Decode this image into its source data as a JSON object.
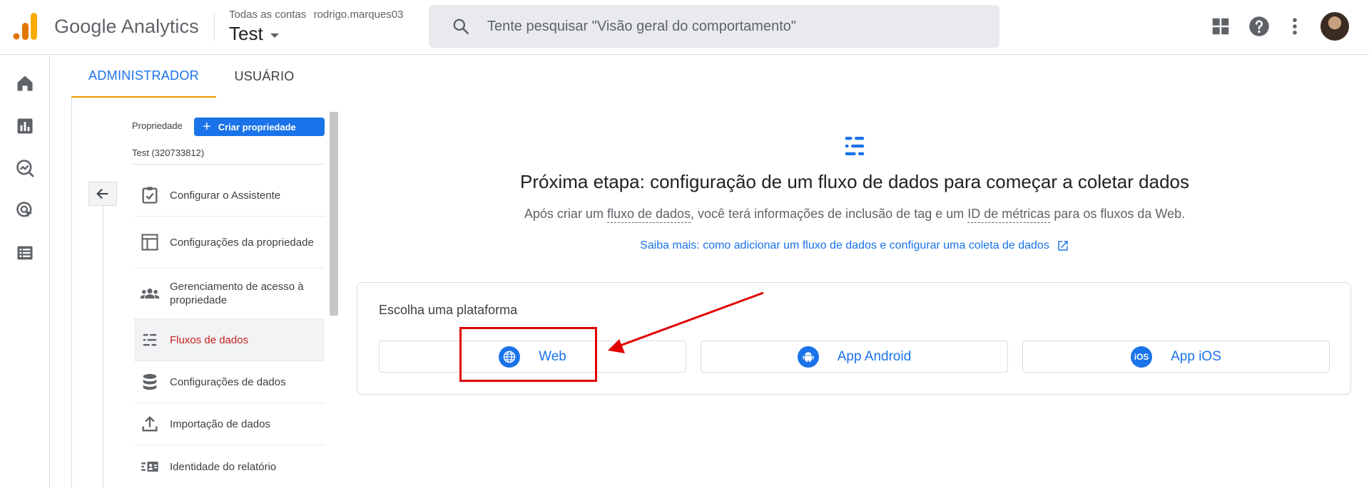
{
  "header": {
    "brand": "Google Analytics",
    "account_crumb": "Todas as contas",
    "account_user": "rodrigo.marques03",
    "property_name": "Test",
    "search_placeholder": "Tente pesquisar \"Visão geral do comportamento\"",
    "icons": [
      "apps-grid-icon",
      "help-icon",
      "more-vert-icon",
      "user-avatar"
    ]
  },
  "rail": {
    "icons": [
      "home-icon",
      "reports-icon",
      "explore-icon",
      "advertising-icon",
      "configure-icon"
    ]
  },
  "tabs": [
    {
      "label": "ADMINISTRADOR",
      "active": true
    },
    {
      "label": "USUÁRIO",
      "active": false
    }
  ],
  "property_panel": {
    "label": "Propriedade",
    "create_button": "Criar propriedade",
    "property_id": "Test (320733812)",
    "nav": [
      {
        "label": "Configurar o Assistente",
        "icon": "checklist-icon"
      },
      {
        "label": "Configurações da propriedade",
        "icon": "property-settings-icon"
      },
      {
        "label": "Gerenciamento de acesso à propriedade",
        "icon": "people-icon"
      },
      {
        "label": "Fluxos de dados",
        "icon": "data-streams-icon",
        "selected": true
      },
      {
        "label": "Configurações de dados",
        "icon": "database-icon"
      },
      {
        "label": "Importação de dados",
        "icon": "upload-icon"
      },
      {
        "label": "Identidade do relatório",
        "icon": "report-identity-icon"
      }
    ]
  },
  "main": {
    "title": "Próxima etapa: configuração de um fluxo de dados para começar a coletar dados",
    "desc_part1": "Após criar um ",
    "desc_term1": "fluxo de dados",
    "desc_part2": ", você terá informações de inclusão de tag e um ",
    "desc_term2": "ID de métricas",
    "desc_part3": " para os fluxos da Web.",
    "learn_more": "Saiba mais: como adicionar um fluxo de dados e configurar uma coleta de dados",
    "platform_label": "Escolha uma plataforma",
    "platforms": [
      {
        "label": "Web",
        "icon": "globe-icon"
      },
      {
        "label": "App Android",
        "icon": "android-icon"
      },
      {
        "label": "App iOS",
        "icon": "ios-icon",
        "icon_text": "iOS"
      }
    ]
  },
  "colors": {
    "accent": "#1a73e8",
    "tab_indicator": "#f29900",
    "selected_nav_text": "#c5221f",
    "annotation_red": "#e00000"
  }
}
